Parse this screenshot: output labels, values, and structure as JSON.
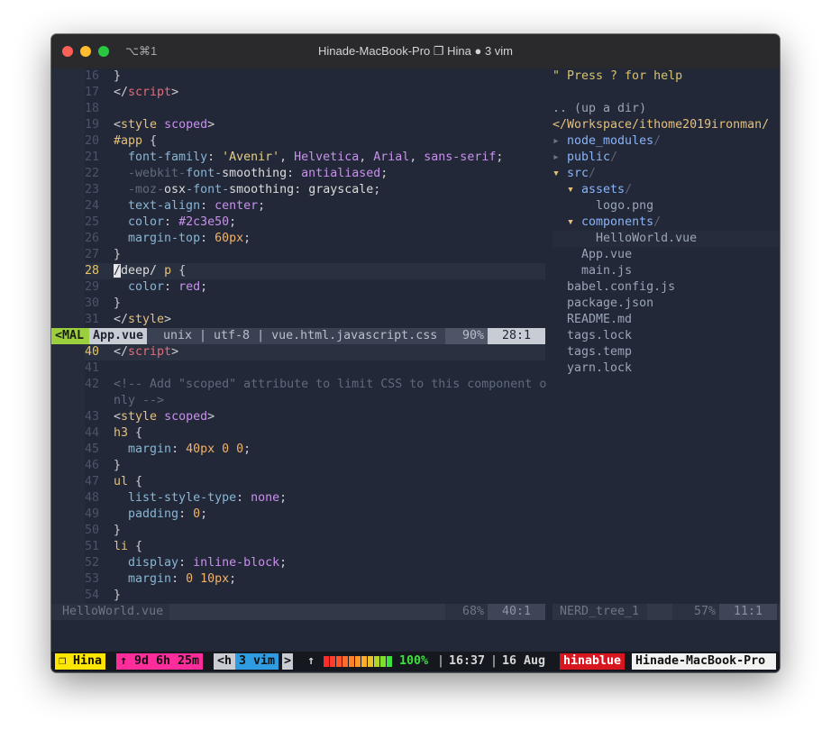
{
  "window": {
    "shortcut": "⌥⌘1",
    "title": "Hinade-MacBook-Pro ❐ Hina ● 3 vim"
  },
  "top_pane": {
    "lines": [
      {
        "num": "16",
        "parts": [
          [
            "c-p",
            "}"
          ]
        ]
      },
      {
        "num": "17",
        "parts": [
          [
            "c-p",
            "</"
          ],
          [
            "c-t",
            "script"
          ],
          [
            "c-p",
            ">"
          ]
        ]
      },
      {
        "num": "18",
        "parts": []
      },
      {
        "num": "19",
        "parts": [
          [
            "c-p",
            "<"
          ],
          [
            "c-tag",
            "style"
          ],
          [
            "c-p",
            " "
          ],
          [
            "c-a",
            "scoped"
          ],
          [
            "c-p",
            ">"
          ]
        ]
      },
      {
        "num": "20",
        "parts": [
          [
            "c-sel",
            "#app"
          ],
          [
            "c-p",
            " {"
          ]
        ]
      },
      {
        "num": "21",
        "parts": [
          [
            "c-p",
            "  "
          ],
          [
            "c-prop",
            "font-family"
          ],
          [
            "c-p",
            ": "
          ],
          [
            "c-s",
            "'Avenir'"
          ],
          [
            "c-p",
            ", "
          ],
          [
            "c-a",
            "Helvetica"
          ],
          [
            "c-p",
            ", "
          ],
          [
            "c-a",
            "Arial"
          ],
          [
            "c-p",
            ", "
          ],
          [
            "c-a",
            "sans-serif"
          ],
          [
            "c-p",
            ";"
          ]
        ]
      },
      {
        "num": "22",
        "parts": [
          [
            "c-p",
            "  "
          ],
          [
            "c-com",
            "-webkit-"
          ],
          [
            "c-prop",
            "font-"
          ],
          [
            "c-w",
            "smoothing"
          ],
          [
            "c-p",
            ": "
          ],
          [
            "c-a",
            "antialiased"
          ],
          [
            "c-p",
            ";"
          ]
        ]
      },
      {
        "num": "23",
        "parts": [
          [
            "c-p",
            "  "
          ],
          [
            "c-com",
            "-moz-"
          ],
          [
            "c-w",
            "osx"
          ],
          [
            "c-prop",
            "-font-"
          ],
          [
            "c-w",
            "smoothing"
          ],
          [
            "c-p",
            ": "
          ],
          [
            "c-w",
            "grayscale"
          ],
          [
            "c-p",
            ";"
          ]
        ]
      },
      {
        "num": "24",
        "parts": [
          [
            "c-p",
            "  "
          ],
          [
            "c-prop",
            "text-align"
          ],
          [
            "c-p",
            ": "
          ],
          [
            "c-a",
            "center"
          ],
          [
            "c-p",
            ";"
          ]
        ]
      },
      {
        "num": "25",
        "parts": [
          [
            "c-p",
            "  "
          ],
          [
            "c-prop",
            "color"
          ],
          [
            "c-p",
            ": "
          ],
          [
            "c-a",
            "#2c3e50"
          ],
          [
            "c-p",
            ";"
          ]
        ]
      },
      {
        "num": "26",
        "parts": [
          [
            "c-p",
            "  "
          ],
          [
            "c-prop",
            "margin-top"
          ],
          [
            "c-p",
            ": "
          ],
          [
            "c-num",
            "60px"
          ],
          [
            "c-p",
            ";"
          ]
        ]
      },
      {
        "num": "27",
        "parts": [
          [
            "c-p",
            "}"
          ]
        ]
      },
      {
        "num": "28",
        "cur": true,
        "parts": [
          [
            "cursor",
            "/"
          ],
          [
            "c-w",
            "deep/ "
          ],
          [
            "c-sel",
            "p"
          ],
          [
            "c-p",
            " {"
          ]
        ]
      },
      {
        "num": "29",
        "parts": [
          [
            "c-p",
            "  "
          ],
          [
            "c-prop",
            "color"
          ],
          [
            "c-p",
            ": "
          ],
          [
            "c-a",
            "red"
          ],
          [
            "c-p",
            ";"
          ]
        ]
      },
      {
        "num": "30",
        "parts": [
          [
            "c-p",
            "}"
          ]
        ]
      },
      {
        "num": "31",
        "parts": [
          [
            "c-p",
            "</"
          ],
          [
            "c-tag",
            "style"
          ],
          [
            "c-p",
            ">"
          ]
        ]
      }
    ],
    "status": {
      "mode": "<MAL",
      "file": "App.vue",
      "info": "unix | utf-8 | vue.html.javascript.css",
      "percent": "90%",
      "pos": "28:1"
    }
  },
  "bottom_pane": {
    "lines": [
      {
        "num": "40",
        "cur": true,
        "parts": [
          [
            "c-p",
            "</"
          ],
          [
            "c-t",
            "script"
          ],
          [
            "c-p",
            ">"
          ]
        ]
      },
      {
        "num": "41",
        "parts": []
      },
      {
        "num": "42",
        "parts": [
          [
            "c-com",
            "<!-- Add \"scoped\" attribute to limit CSS to this component o"
          ]
        ]
      },
      {
        "num": "",
        "parts": [
          [
            "c-com",
            "nly -->"
          ]
        ]
      },
      {
        "num": "43",
        "parts": [
          [
            "c-p",
            "<"
          ],
          [
            "c-tag",
            "style"
          ],
          [
            "c-p",
            " "
          ],
          [
            "c-a",
            "scoped"
          ],
          [
            "c-p",
            ">"
          ]
        ]
      },
      {
        "num": "44",
        "parts": [
          [
            "c-sel",
            "h3"
          ],
          [
            "c-p",
            " {"
          ]
        ]
      },
      {
        "num": "45",
        "parts": [
          [
            "c-p",
            "  "
          ],
          [
            "c-prop",
            "margin"
          ],
          [
            "c-p",
            ": "
          ],
          [
            "c-num",
            "40px 0 0"
          ],
          [
            "c-p",
            ";"
          ]
        ]
      },
      {
        "num": "46",
        "parts": [
          [
            "c-p",
            "}"
          ]
        ]
      },
      {
        "num": "47",
        "parts": [
          [
            "c-sel",
            "ul"
          ],
          [
            "c-p",
            " {"
          ]
        ]
      },
      {
        "num": "48",
        "parts": [
          [
            "c-p",
            "  "
          ],
          [
            "c-prop",
            "list-style-type"
          ],
          [
            "c-p",
            ": "
          ],
          [
            "c-a",
            "none"
          ],
          [
            "c-p",
            ";"
          ]
        ]
      },
      {
        "num": "49",
        "parts": [
          [
            "c-p",
            "  "
          ],
          [
            "c-prop",
            "padding"
          ],
          [
            "c-p",
            ": "
          ],
          [
            "c-num",
            "0"
          ],
          [
            "c-p",
            ";"
          ]
        ]
      },
      {
        "num": "50",
        "parts": [
          [
            "c-p",
            "}"
          ]
        ]
      },
      {
        "num": "51",
        "parts": [
          [
            "c-sel",
            "li"
          ],
          [
            "c-p",
            " {"
          ]
        ]
      },
      {
        "num": "52",
        "parts": [
          [
            "c-p",
            "  "
          ],
          [
            "c-prop",
            "display"
          ],
          [
            "c-p",
            ": "
          ],
          [
            "c-a",
            "inline-block"
          ],
          [
            "c-p",
            ";"
          ]
        ]
      },
      {
        "num": "53",
        "parts": [
          [
            "c-p",
            "  "
          ],
          [
            "c-prop",
            "margin"
          ],
          [
            "c-p",
            ": "
          ],
          [
            "c-num",
            "0 10px"
          ],
          [
            "c-p",
            ";"
          ]
        ]
      },
      {
        "num": "54",
        "parts": [
          [
            "c-p",
            "}"
          ]
        ]
      }
    ],
    "status": {
      "file": "HelloWorld.vue",
      "percent": "68%",
      "pos": "40:1"
    }
  },
  "tree": {
    "help": "\" Press ? for help",
    "updir": ".. (up a dir)",
    "root": "</Workspace/ithome2019ironman/",
    "items": [
      {
        "indent": "",
        "arrow": "▸ ",
        "name": "node_modules",
        "slash": "/",
        "kind": "dir",
        "arrowColor": "arr"
      },
      {
        "indent": "",
        "arrow": "▸ ",
        "name": "public",
        "slash": "/",
        "kind": "dir",
        "arrowColor": "arr"
      },
      {
        "indent": "",
        "arrow": "▾ ",
        "name": "src",
        "slash": "/",
        "kind": "dir",
        "arrowColor": "arry"
      },
      {
        "indent": "  ",
        "arrow": "▾ ",
        "name": "assets",
        "slash": "/",
        "kind": "dir",
        "arrowColor": "arry"
      },
      {
        "indent": "      ",
        "arrow": "",
        "name": "logo.png",
        "slash": "",
        "kind": "file"
      },
      {
        "indent": "  ",
        "arrow": "▾ ",
        "name": "components",
        "slash": "/",
        "kind": "dir",
        "arrowColor": "arry"
      },
      {
        "indent": "      ",
        "arrow": "",
        "name": "HelloWorld.vue",
        "slash": "",
        "kind": "file",
        "sel": true
      },
      {
        "indent": "    ",
        "arrow": "",
        "name": "App.vue",
        "slash": "",
        "kind": "file"
      },
      {
        "indent": "    ",
        "arrow": "",
        "name": "main.js",
        "slash": "",
        "kind": "file"
      },
      {
        "indent": "  ",
        "arrow": "",
        "name": "babel.config.js",
        "slash": "",
        "kind": "file"
      },
      {
        "indent": "  ",
        "arrow": "",
        "name": "package.json",
        "slash": "",
        "kind": "file"
      },
      {
        "indent": "  ",
        "arrow": "",
        "name": "README.md",
        "slash": "",
        "kind": "file"
      },
      {
        "indent": "  ",
        "arrow": "",
        "name": "tags.lock",
        "slash": "",
        "kind": "file"
      },
      {
        "indent": "  ",
        "arrow": "",
        "name": "tags.temp",
        "slash": "",
        "kind": "file"
      },
      {
        "indent": "  ",
        "arrow": "",
        "name": "yarn.lock",
        "slash": "",
        "kind": "file"
      }
    ],
    "status": {
      "name": "NERD_tree_1",
      "percent": "57%",
      "pos": "11:1"
    }
  },
  "tmux": {
    "session": "❐ Hina",
    "uptime": "↑ 9d 6h 25m",
    "window_prev": "<h",
    "window_cur": "3 vim",
    "window_next": ">",
    "up_arrow": "↑",
    "battery": "100%",
    "battery_level": 1.0,
    "time": "16:37",
    "date": "16 Aug",
    "user": "hinablue",
    "host": "Hinade-MacBook-Pro",
    "colors": {
      "session": "#ffe600",
      "uptime": "#ff2d9c",
      "window": "#2f9be0",
      "user": "#d7161f",
      "host": "#f2f2f2"
    }
  }
}
